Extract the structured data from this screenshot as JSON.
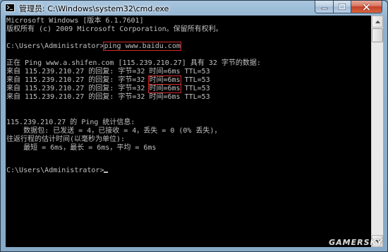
{
  "window": {
    "title": "管理员: C:\\Windows\\system32\\cmd.exe"
  },
  "console": {
    "line_01": "Microsoft Windows [版本 6.1.7601]",
    "line_02": "版权所有 (c) 2009 Microsoft Corporation。保留所有权利。",
    "prompt_1": "C:\\Users\\Administrator>",
    "command_1": "ping www.baidu.com",
    "ping_header": "正在 Ping www.a.shifen.com [115.239.210.27] 具有 32 字节的数据:",
    "reply_prefix": "来自 115.239.210.27 的回复: 字节=32 ",
    "reply_1_time": "时间=6ms",
    "reply_2_time": "时间=6ms",
    "reply_3_time": "时间=6ms",
    "reply_4_time": "时间=6ms",
    "reply_ttl": " TTL=53",
    "stats_header": "115.239.210.27 的 Ping 统计信息:",
    "stats_packets": "    数据包: 已发送 = 4，已接收 = 4，丢失 = 0 (0% 丢失)，",
    "stats_rtt_header": "往返行程的估计时间(以毫秒为单位):",
    "stats_rtt_values": "    最短 = 6ms，最长 = 6ms，平均 = 6ms",
    "prompt_2": "C:\\Users\\Administrator>"
  },
  "watermark": "GAMERSKY",
  "icons": {
    "title_icon": "cmd-icon",
    "minimize": "minimize-icon",
    "maximize": "maximize-icon",
    "close": "close-icon",
    "scroll_up": "scroll-up-arrow-icon",
    "scroll_down": "scroll-down-arrow-icon"
  },
  "colors": {
    "console_background": "#000000",
    "console_text": "#c0c0c0",
    "highlight_box": "#d72a2a",
    "close_button": "#c1402a"
  }
}
